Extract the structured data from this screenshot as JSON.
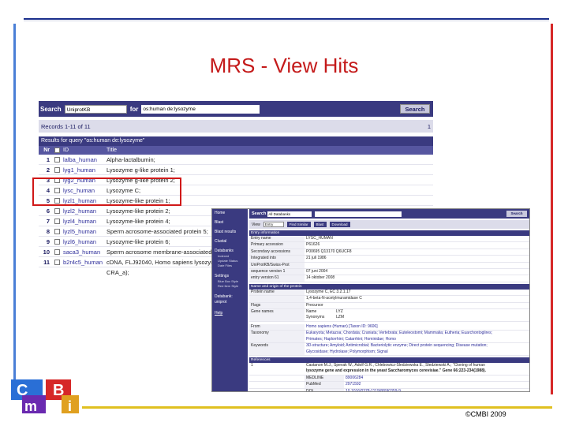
{
  "slide": {
    "title": "MRS - View Hits",
    "copyright": "©CMBI 2009",
    "logo": {
      "letters": [
        "C",
        "m",
        "B",
        "i"
      ],
      "colors": [
        "#2a6fd6",
        "#6a2ab0",
        "#d62828",
        "#e0a020"
      ]
    }
  },
  "left": {
    "search_label": "Search",
    "databank": "UniprotKB",
    "for_label": "for",
    "query": "os:human de:lysozyme",
    "search_button": "Search",
    "records": "Records 1-11 of 11",
    "page": "1",
    "results_header": "Results for query \"os:human de:lysozyme\"",
    "columns": {
      "nr": "Nr",
      "id": "ID",
      "title": "Title"
    },
    "rows": [
      {
        "nr": "1",
        "id": "lalba_human",
        "title": "Alpha-lactalbumin;"
      },
      {
        "nr": "2",
        "id": "lyg1_human",
        "title": "Lysozyme g-like protein 1;"
      },
      {
        "nr": "3",
        "id": "lyg2_human",
        "title": "Lysozyme g-like protein 2;"
      },
      {
        "nr": "4",
        "id": "lysc_human",
        "title": "Lysozyme C;"
      },
      {
        "nr": "5",
        "id": "lyzl1_human",
        "title": "Lysozyme-like protein 1;"
      },
      {
        "nr": "6",
        "id": "lyzl2_human",
        "title": "Lysozyme-like protein 2;"
      },
      {
        "nr": "7",
        "id": "lyzl4_human",
        "title": "Lysozyme-like protein 4;"
      },
      {
        "nr": "8",
        "id": "lyzl5_human",
        "title": "Sperm acrosome-associated protein 5;"
      },
      {
        "nr": "9",
        "id": "lyzl6_human",
        "title": "Lysozyme-like protein 6;"
      },
      {
        "nr": "10",
        "id": "saca3_human",
        "title": "Sperm acrosome membrane-associated"
      },
      {
        "nr": "11",
        "id": "b2r4c5_human",
        "title": "cDNA, FLJ92040, Homo sapiens lysozyme"
      }
    ],
    "row11_cont": "CRA_a);"
  },
  "right": {
    "sidebar": {
      "home": "Home",
      "blast": "Blast",
      "blast_results": "Blast results",
      "clustal": "Clustal",
      "databanks": "Databanks",
      "db_items": [
        "Indexed",
        "Update Status",
        "Date Files"
      ],
      "settings": "Settings",
      "settings_items": [
        "Blue Box Style",
        "Red Item Style"
      ],
      "databank": "Databank:",
      "databank_name": "uniprot",
      "help": "Help"
    },
    "search_label": "Search",
    "databank": "All Databanks",
    "search_button": "Search",
    "view_label": "View",
    "view_value": "Entry",
    "buttons": [
      "Find Similar",
      "Blast",
      "Download"
    ],
    "entry_section": "Entry information",
    "entry_rows": [
      {
        "k": "Entry name",
        "v": "LYSC_HUMAN"
      },
      {
        "k": "Primary accession",
        "v": "P61626"
      },
      {
        "k": "Secondary accessions",
        "v": "P00695 Q13170 Q6UCF8"
      },
      {
        "k": "Integrated into",
        "v": "21 juli 1986"
      },
      {
        "k": "UniProtKB/Swiss-Prot",
        "v": ""
      },
      {
        "k": "sequence version 1",
        "v": "07 juni 2004"
      },
      {
        "k": "entry version 61",
        "v": "14 oktober 2008"
      }
    ],
    "name_section": "Name and origin of the protein",
    "name_rows": [
      {
        "k": "Protein name",
        "v": "Lysozyme C, EC 3.2.1.17"
      },
      {
        "k": "",
        "v": "1,4-beta-N-acetylmuramidase C"
      },
      {
        "k": "Flags",
        "v": "Precursor"
      }
    ],
    "gene_rows": [
      {
        "k": "Name",
        "v": "LYZ"
      },
      {
        "k": "Synonyms",
        "v": "LZM"
      }
    ],
    "gene_label": "Gene names",
    "from": {
      "k": "From",
      "v": "Homo sapiens (Human) [Taxon ID: 9606]"
    },
    "taxonomy": {
      "k": "Taxonomy",
      "v1": "Eukaryota; Metazoa; Chordata; Craniata; Vertebrata; Euteleostomi; Mammalia; Eutheria; Euarchontoglires;",
      "v2": "Primates; Haplorrhini; Catarrhini; Hominidae; Homo"
    },
    "keywords": {
      "k": "Keywords",
      "v1": "3D-structure; Amyloid; Antimicrobial; Bacteriolytic enzyme; Direct protein sequencing; Disease mutation;",
      "v2": "Glycosidase; Hydrolase; Polymorphism; Signal"
    },
    "ref_section": "References",
    "ref": {
      "n": "1",
      "authors": "Castanon M.J., Spevak W., Adolf G.R., Chlebowicz-Sledziewska E., Sledziewski A.; \"Cloning of human",
      "title": "lysozyme gene and expression in the yeast Saccharomyces cerevisiae.\" Gene 66:223-234(1988).",
      "xrefs": [
        {
          "k": "MEDLINE",
          "v": "89006284"
        },
        {
          "k": "PubMed",
          "v": "2971592"
        },
        {
          "k": "DOI",
          "v": "10.1016/0378-1119(88)90359-9"
        },
        {
          "k": "Reference Position",
          "v": "nucleotide sequence [mrna]."
        }
      ]
    }
  }
}
